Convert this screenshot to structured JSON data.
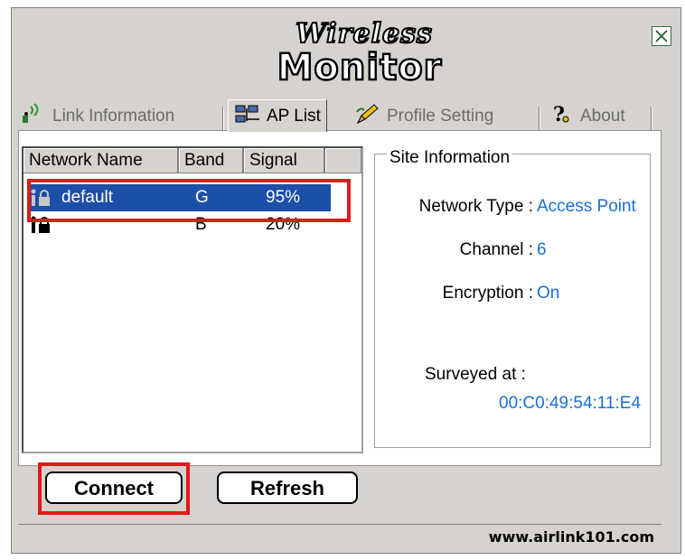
{
  "window": {
    "logo_top": "Wireless",
    "logo_bottom": "Monitor",
    "close_glyph": "✕"
  },
  "tabs": [
    {
      "label": "Link Information",
      "icon": "antenna-icon",
      "active": false
    },
    {
      "label": "AP List",
      "icon": "network-icon",
      "active": true
    },
    {
      "label": "Profile Setting",
      "icon": "pencil-icon",
      "active": false
    },
    {
      "label": "About",
      "icon": "question-icon",
      "active": false
    }
  ],
  "ap_list": {
    "columns": [
      "Network Name",
      "Band",
      "Signal"
    ],
    "rows": [
      {
        "name": "default",
        "band": "G",
        "signal": "95%",
        "selected": true
      },
      {
        "name": "",
        "band": "B",
        "signal": "20%",
        "selected": false
      }
    ]
  },
  "site_info": {
    "title": "Site Information",
    "network_type_label": "Network Type :",
    "network_type_value": "Access Point",
    "channel_label": "Channel :",
    "channel_value": "6",
    "encryption_label": "Encryption :",
    "encryption_value": "On",
    "surveyed_label": "Surveyed at :",
    "surveyed_value": "00:C0:49:54:11:E4"
  },
  "buttons": {
    "connect": "Connect",
    "refresh": "Refresh"
  },
  "footer": {
    "url": "www.airlink101.com"
  },
  "colors": {
    "selection": "#1c4fa8",
    "value_text": "#1a6fd6",
    "highlight": "#e01a1a"
  }
}
